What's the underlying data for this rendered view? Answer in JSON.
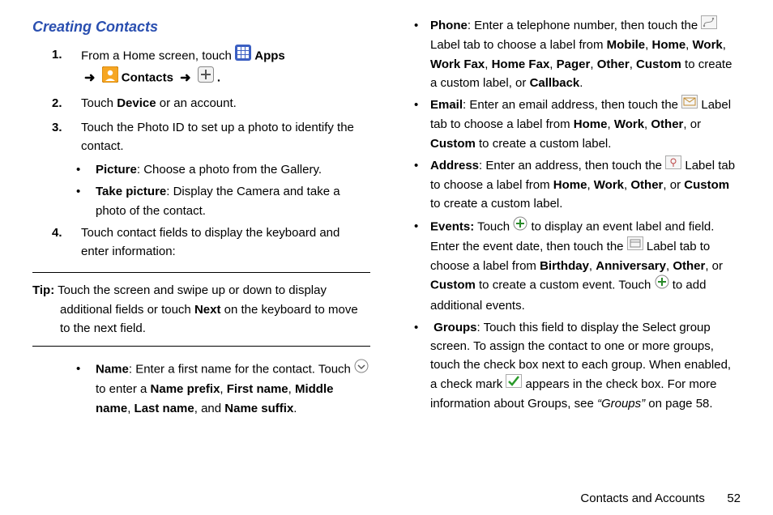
{
  "heading": "Creating Contacts",
  "step1_a": "From a Home screen, touch ",
  "step1_apps": "Apps",
  "step1_contacts": "Contacts",
  "step1_period": ".",
  "step2_a": "Touch ",
  "step2_b": "Device",
  "step2_c": " or an account.",
  "step3": "Touch the Photo ID to set up a photo to identify the contact.",
  "step3_pic_b": "Picture",
  "step3_pic_t": ": Choose a photo from the Gallery.",
  "step3_take_b": "Take picture",
  "step3_take_t": ": Display the Camera and take a photo of the contact.",
  "step4": "Touch contact fields to display the keyboard and enter information:",
  "tip_label": "Tip:",
  "tip_a": " Touch the screen and swipe up or down to display additional fields or touch ",
  "tip_next": "Next",
  "tip_b": " on the keyboard to move to the next field.",
  "name_b": "Name",
  "name_a": ": Enter a first name for the contact. Touch ",
  "name_c": " to enter a ",
  "name_d": "Name prefix",
  "name_e": "First name",
  "name_f": "Middle name",
  "name_g": "Last name",
  "name_h": "Name suffix",
  "comma": ", ",
  "and": ", and ",
  "period": ".",
  "phone_b": "Phone",
  "phone_a": ": Enter a telephone number, then touch the ",
  "phone_c": " Label tab to choose a label from ",
  "phone_l1": "Mobile",
  "phone_l2": "Home",
  "phone_l3": "Work",
  "phone_l4": "Work Fax",
  "phone_l5": "Home Fax",
  "phone_l6": "Pager",
  "phone_l7": "Other",
  "phone_l8": "Custom",
  "phone_d": " to create a custom label, or ",
  "phone_l9": "Callback",
  "email_b": "Email",
  "email_a": ": Enter an email address, then touch the ",
  "email_c": " Label tab to choose a label from ",
  "email_l1": "Home",
  "email_l2": "Work",
  "email_l3": "Other",
  "email_or": ", or ",
  "email_l4": "Custom",
  "email_d": " to create a custom label.",
  "addr_b": "Address",
  "addr_a": ": Enter an address, then touch the ",
  "addr_c": " Label tab to choose a label from ",
  "addr_d": " to create a custom label.",
  "events_b": "Events:",
  "events_a": " Touch ",
  "events_c": " to display an event label and field. Enter the event date, then touch the ",
  "events_d": " Label tab to choose a label from ",
  "events_l1": "Birthday",
  "events_l2": "Anniversary",
  "events_l3": "Other",
  "events_l4": "Custom",
  "events_e": " to create a custom event. Touch ",
  "events_f": " to add additional events.",
  "groups_b": "Groups",
  "groups_a": ": Touch this field to display the Select group screen. To assign the contact to one or more groups, touch the check box next to each group. When enabled, a check mark ",
  "groups_c": " appears in the check box. For more information about Groups, see ",
  "groups_ref": "“Groups”",
  "groups_d": " on page 58.",
  "footer_section": "Contacts and Accounts",
  "footer_page": "52",
  "arrow": "➜"
}
